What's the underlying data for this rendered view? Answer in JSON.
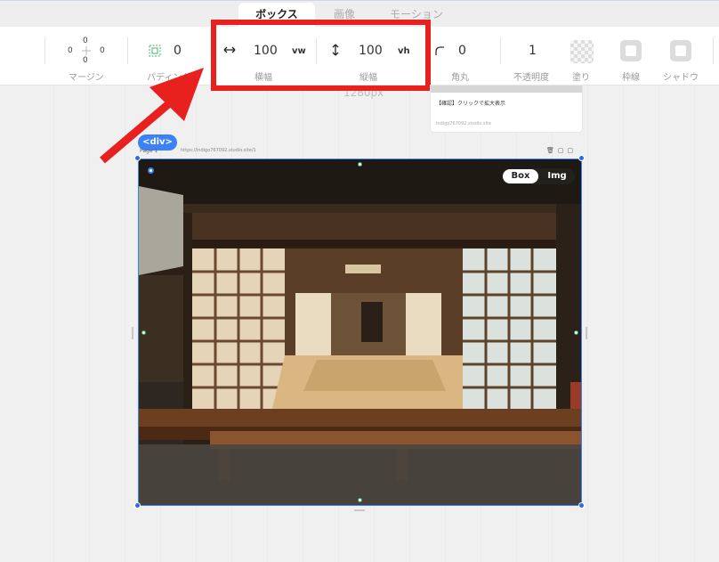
{
  "tabs": [
    {
      "label": "ボックス",
      "active": true
    },
    {
      "label": "画像",
      "active": false
    },
    {
      "label": "モーション",
      "active": false
    }
  ],
  "toolbar": {
    "margin": {
      "top": "0",
      "left": "0",
      "right": "0",
      "bottom": "0",
      "label": "マージン"
    },
    "padding": {
      "value": "0",
      "label": "パディング"
    },
    "width": {
      "value": "100",
      "unit": "vw",
      "label": "横幅"
    },
    "height": {
      "value": "100",
      "unit": "vh",
      "label": "縦幅"
    },
    "radius": {
      "value": "0",
      "label": "角丸"
    },
    "opacity": {
      "value": "1",
      "label": "不透明度"
    },
    "fill_label": "塗り",
    "border_label": "枠線",
    "shadow_label": "シャドウ"
  },
  "canvas": {
    "ruler_label": "1280px",
    "preview": {
      "title": "【確認】クリックで拡大表示",
      "url": "indigo767092.studio.site"
    },
    "selection": {
      "tag": "<div>",
      "page_label": "Page 1",
      "page_url": "https://indigo767092.studio.site/1",
      "toggle": {
        "box": "Box",
        "img": "Img",
        "selected": "Box"
      }
    }
  },
  "colors": {
    "accent": "#3b82f6",
    "annotation": "#e8201e",
    "arrow": "#e8201e"
  }
}
